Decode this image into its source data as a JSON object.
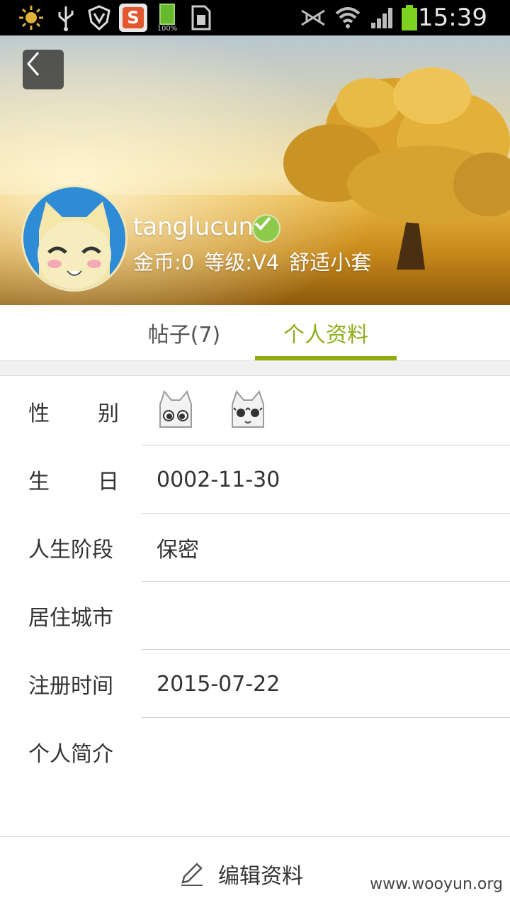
{
  "status_bar": {
    "time": "15:39",
    "battery_small_label": "100%",
    "icons": [
      "weather-sun-icon",
      "usb-icon",
      "shield-icon",
      "sogou-input-icon",
      "battery-full-small-icon",
      "sim-card-icon",
      "no-sim-signal-icon",
      "wifi-icon",
      "cell-signal-icon",
      "battery-icon"
    ]
  },
  "header": {
    "back_icon": "chevron-left-icon",
    "username": "tanglucun",
    "verified_icon": "verified-check-icon",
    "coins": "金币:0",
    "level": "等级:V4",
    "badge": "舒适小套"
  },
  "tabs": [
    {
      "label": "帖子(7)",
      "active": false
    },
    {
      "label": "个人资料",
      "active": true
    }
  ],
  "profile": {
    "gender": {
      "label_chars": [
        "性",
        "别"
      ],
      "options": [
        "male-cat-icon",
        "female-cat-icon"
      ]
    },
    "birthday": {
      "label_chars": [
        "生",
        "日"
      ],
      "value": "0002-11-30"
    },
    "life_stage": {
      "label": "人生阶段",
      "value": "保密"
    },
    "city": {
      "label": "居住城市",
      "value": ""
    },
    "register_time": {
      "label": "注册时间",
      "value": "2015-07-22"
    },
    "bio": {
      "label": "个人简介",
      "value": ""
    }
  },
  "bottom": {
    "edit_label": "编辑资料",
    "edit_icon": "pencil-icon"
  },
  "watermark": "www.wooyun.org",
  "colors": {
    "accent": "#93ab0f",
    "tab_active_text": "#8fae1b",
    "verified": "#8dc94a",
    "status_bar_bg": "#000000",
    "battery": "#7ed321"
  }
}
